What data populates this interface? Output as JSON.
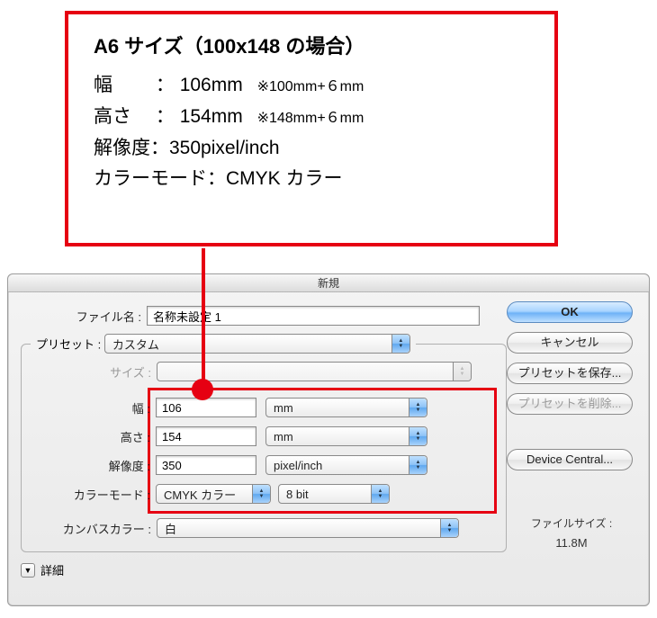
{
  "callout": {
    "title": "A6 サイズ（100x148 の場合）",
    "rows": [
      {
        "label": "幅",
        "sep": "：",
        "value": "106mm",
        "note": "※100mm+６mm"
      },
      {
        "label": "高さ",
        "sep": "：",
        "value": "154mm",
        "note": "※148mm+６mm"
      },
      {
        "label": "解像度：350pixel/inch",
        "sep": "",
        "value": "",
        "note": ""
      },
      {
        "label": "カラーモード：CMYK カラー",
        "sep": "",
        "value": "",
        "note": ""
      }
    ]
  },
  "dialog": {
    "title": "新規",
    "labels": {
      "filename": "ファイル名 :",
      "preset_legend": "プリセット :",
      "size": "サイズ :",
      "width": "幅 :",
      "height": "高さ :",
      "resolution": "解像度 :",
      "color_mode": "カラーモード :",
      "canvas_color": "カンバスカラー :",
      "detail": "詳細"
    },
    "values": {
      "filename": "名称未設定 1",
      "preset": "カスタム",
      "size": "",
      "width": "106",
      "height": "154",
      "resolution": "350",
      "width_unit": "mm",
      "height_unit": "mm",
      "resolution_unit": "pixel/inch",
      "color_mode": "CMYK カラー",
      "bit_depth": "8 bit",
      "canvas_color": "白"
    },
    "buttons": {
      "ok": "OK",
      "cancel": "キャンセル",
      "save_preset": "プリセットを保存...",
      "delete_preset": "プリセットを削除...",
      "device_central": "Device Central..."
    },
    "filesize": {
      "label": "ファイルサイズ :",
      "value": "11.8M"
    },
    "disclosure_glyph": "▼"
  }
}
